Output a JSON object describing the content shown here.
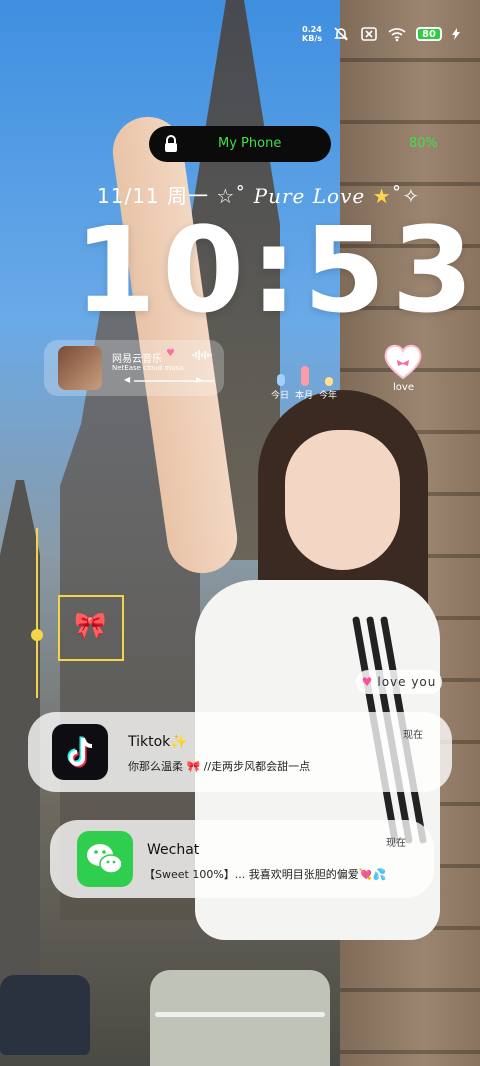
{
  "status_bar": {
    "net_speed_value": "0.24",
    "net_speed_unit": "KB/s",
    "battery_level": "80",
    "icons": [
      "mute-bell-icon",
      "no-sim-icon",
      "wifi-icon",
      "battery-icon",
      "charging-bolt-icon"
    ]
  },
  "lock_pill": {
    "device_name": "My Phone",
    "battery_percent": "80%",
    "icon": "lock-icon"
  },
  "date_line": {
    "date": "11/11",
    "weekday": "周一",
    "tagline": "Pure Love"
  },
  "clock": {
    "time": "10:53"
  },
  "music_widget": {
    "app_name": "网易云音乐",
    "app_subtitle": "NetEase cloud music",
    "icons": [
      "album-art",
      "heart-icon",
      "waveform-icon",
      "prev-icon",
      "next-icon"
    ]
  },
  "stats_widget": {
    "labels": [
      "今日",
      "本月",
      "今年"
    ],
    "bar_levels": [
      0.45,
      0.75,
      0.35
    ],
    "bar_colors": [
      "#9fd0ff",
      "#ff9aa8",
      "#ffe08a"
    ]
  },
  "heart_widget": {
    "label": "love",
    "icon": "heart-bow-icon"
  },
  "love_chip": {
    "text": "love you",
    "icon": "pink-heart-icon"
  },
  "notifications": [
    {
      "app": "Tiktok",
      "title": "Tiktok✨",
      "body": "你那么温柔 🎀 //走两步风都会甜一点",
      "time": "现在",
      "icon": "tiktok-icon"
    },
    {
      "app": "Wechat",
      "title": "Wechat",
      "body": "【Sweet 100%】... 我喜欢明目张胆的偏爱💘💦",
      "time": "现在",
      "icon": "wechat-icon"
    }
  ]
}
